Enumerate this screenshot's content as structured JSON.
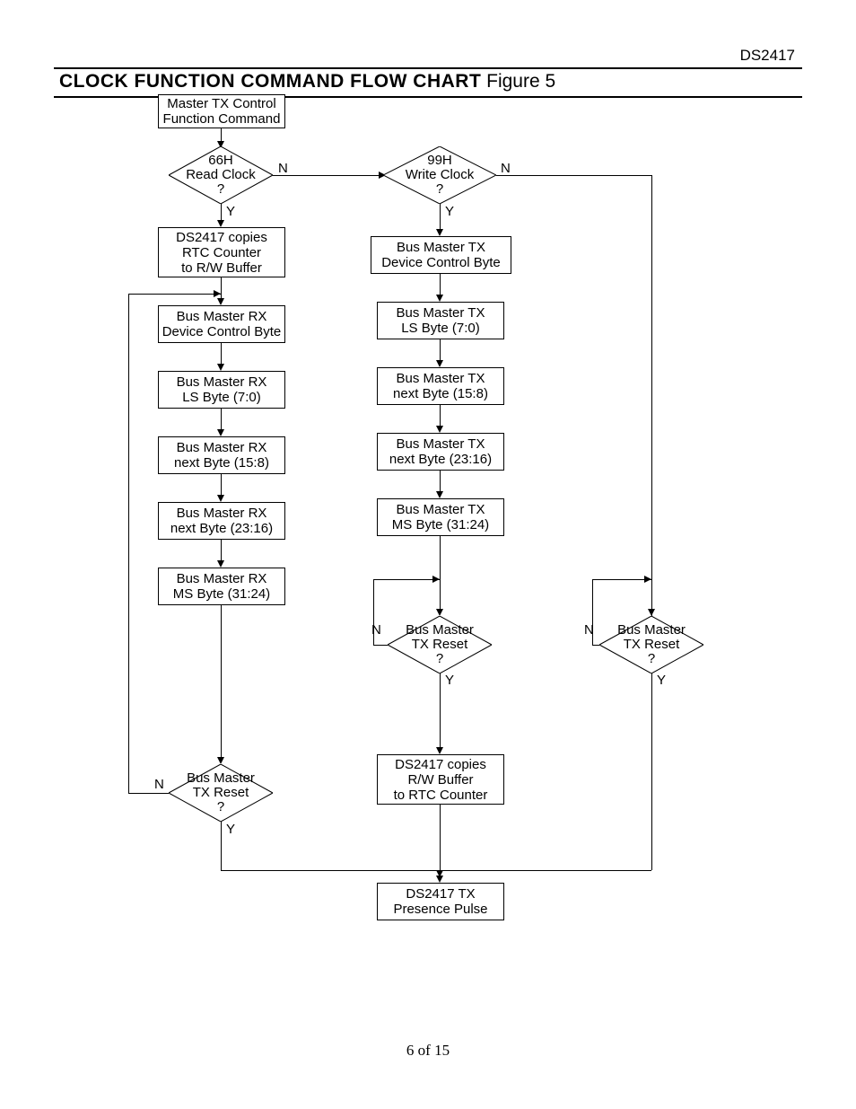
{
  "header": {
    "part": "DS2417"
  },
  "title": {
    "bold": "CLOCK FUNCTION COMMAND FLOW CHART",
    "rest": " Figure 5"
  },
  "footer": {
    "page": "6 of 15"
  },
  "labels": {
    "yes": "Y",
    "no": "N"
  },
  "nodes": {
    "start": {
      "l1": "Master TX Control",
      "l2": "Function Command"
    },
    "d_read": {
      "l1": "66H",
      "l2": "Read Clock",
      "l3": "?"
    },
    "d_write": {
      "l1": "99H",
      "l2": "Write Clock",
      "l3": "?"
    },
    "rcopy": {
      "l1": "DS2417 copies",
      "l2": "RTC Counter",
      "l3": "to R/W Buffer"
    },
    "rx_ctrl": {
      "l1": "Bus Master RX",
      "l2": "Device Control Byte"
    },
    "rx_ls": {
      "l1": "Bus Master RX",
      "l2": "LS Byte (7:0)"
    },
    "rx_b2": {
      "l1": "Bus Master RX",
      "l2": "next Byte (15:8)"
    },
    "rx_b3": {
      "l1": "Bus Master RX",
      "l2": "next Byte (23:16)"
    },
    "rx_ms": {
      "l1": "Bus Master RX",
      "l2": "MS Byte (31:24)"
    },
    "tx_ctrl": {
      "l1": "Bus Master TX",
      "l2": "Device Control Byte"
    },
    "tx_ls": {
      "l1": "Bus Master TX",
      "l2": "LS Byte (7:0)"
    },
    "tx_b2": {
      "l1": "Bus Master TX",
      "l2": "next Byte (15:8)"
    },
    "tx_b3": {
      "l1": "Bus Master TX",
      "l2": "next Byte (23:16)"
    },
    "tx_ms": {
      "l1": "Bus Master TX",
      "l2": "MS Byte (31:24)"
    },
    "d_reset_l": {
      "l1": "Bus Master",
      "l2": "TX Reset",
      "l3": "?"
    },
    "d_reset_m": {
      "l1": "Bus Master",
      "l2": "TX Reset",
      "l3": "?"
    },
    "d_reset_r": {
      "l1": "Bus Master",
      "l2": "TX Reset",
      "l3": "?"
    },
    "wcopy": {
      "l1": "DS2417 copies",
      "l2": "R/W Buffer",
      "l3": "to RTC Counter"
    },
    "presence": {
      "l1": "DS2417 TX",
      "l2": "Presence Pulse"
    }
  }
}
